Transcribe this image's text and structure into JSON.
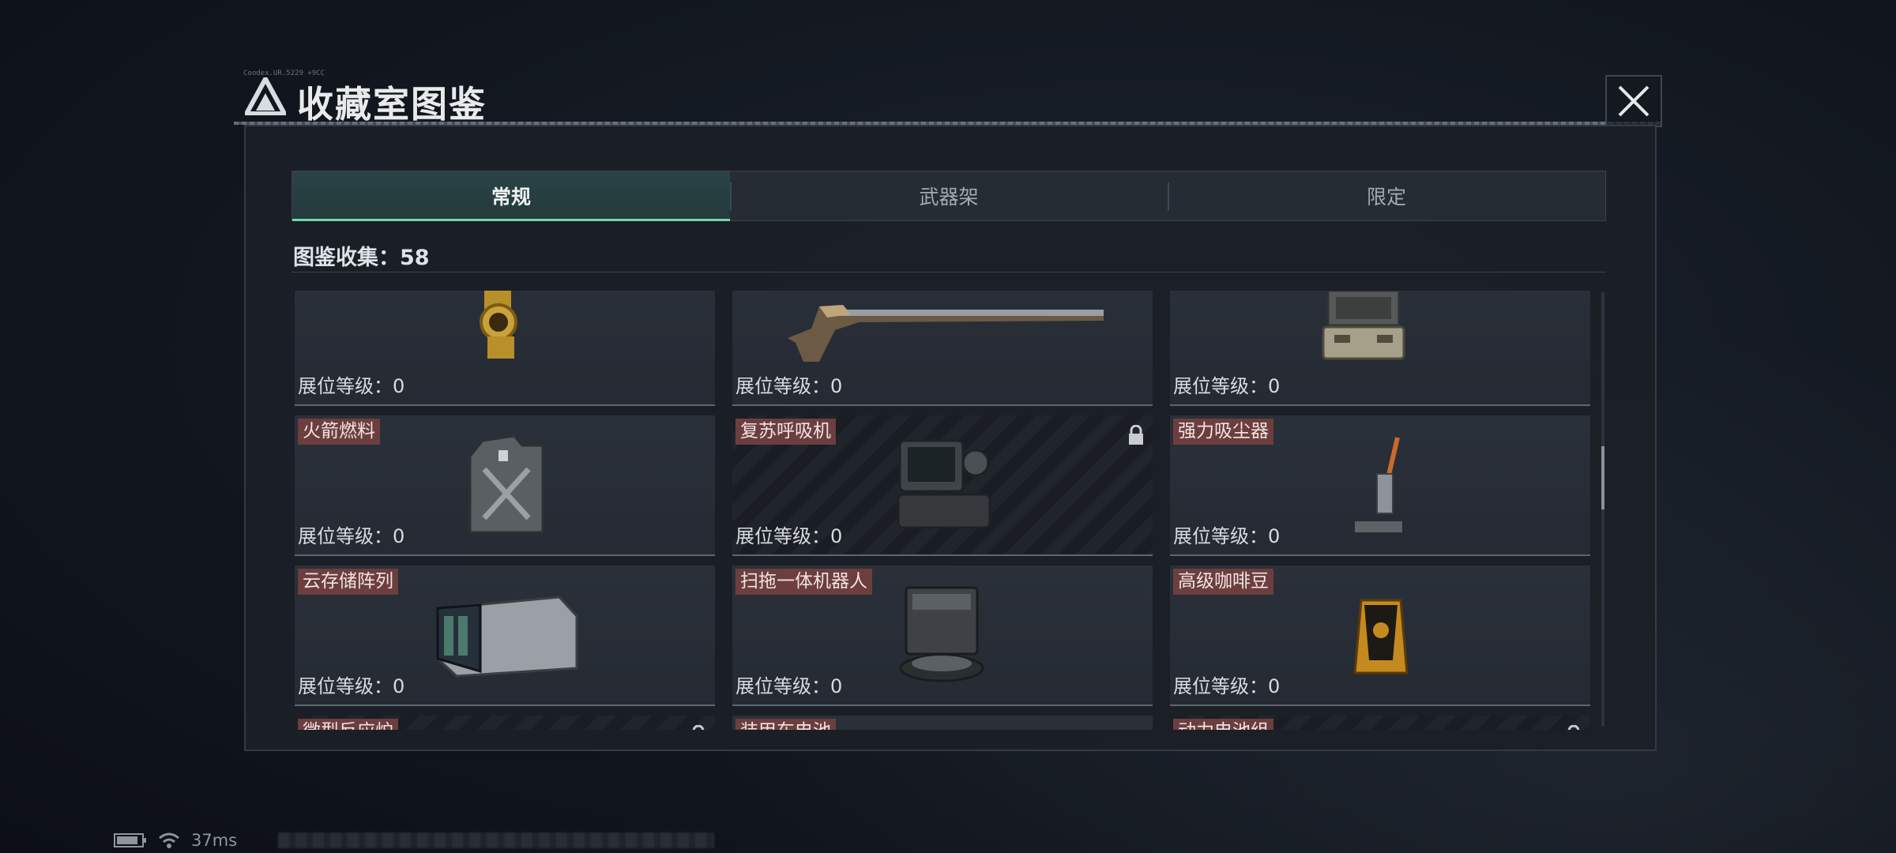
{
  "header": {
    "title": "收藏室图鉴",
    "small_code": "Coodex.UR.5229  +9CC"
  },
  "tabs": [
    {
      "label": "常规",
      "active": true
    },
    {
      "label": "武器架",
      "active": false
    },
    {
      "label": "限定",
      "active": false
    }
  ],
  "collection": {
    "label": "图鉴收集：58"
  },
  "level_label": "展位等级：",
  "items": [
    {
      "name": "",
      "level": "0",
      "locked": false,
      "icon": "gold-watch-icon"
    },
    {
      "name": "",
      "level": "0",
      "locked": false,
      "icon": "rifle-icon"
    },
    {
      "name": "",
      "level": "0",
      "locked": false,
      "icon": "equipment-case-icon"
    },
    {
      "name": "火箭燃料",
      "level": "0",
      "locked": false,
      "icon": "fuel-canister-icon"
    },
    {
      "name": "复苏呼吸机",
      "level": "0",
      "locked": true,
      "icon": "ventilator-icon"
    },
    {
      "name": "强力吸尘器",
      "level": "0",
      "locked": false,
      "icon": "vacuum-cleaner-icon"
    },
    {
      "name": "云存储阵列",
      "level": "0",
      "locked": false,
      "icon": "storage-array-icon"
    },
    {
      "name": "扫拖一体机器人",
      "level": "0",
      "locked": false,
      "icon": "robot-vacuum-icon"
    },
    {
      "name": "高级咖啡豆",
      "level": "0",
      "locked": false,
      "icon": "coffee-bag-icon"
    },
    {
      "name": "微型反应炉",
      "level": "",
      "locked": true,
      "icon": "reactor-icon"
    },
    {
      "name": "装甲车电池",
      "level": "",
      "locked": false,
      "icon": "battery-icon"
    },
    {
      "name": "动力电池组",
      "level": "",
      "locked": true,
      "icon": "battery-pack-icon"
    }
  ],
  "status": {
    "ping": "37ms"
  },
  "colors": {
    "accent": "#6fd7a8",
    "name_tag": "#6c3e3e",
    "panel": "#1b1f26"
  }
}
